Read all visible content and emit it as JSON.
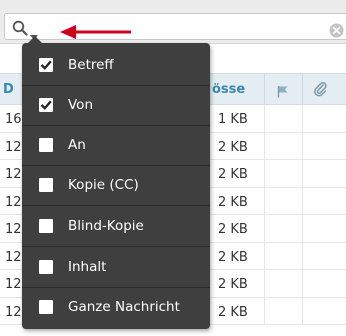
{
  "header": {
    "first_column_label": "D",
    "size_column_label": "össe"
  },
  "rows": [
    {
      "id": "16",
      "size": "1 KB"
    },
    {
      "id": "12",
      "size": "2 KB"
    },
    {
      "id": "12",
      "size": "2 KB"
    },
    {
      "id": "12",
      "size": "2 KB"
    },
    {
      "id": "12",
      "size": "2 KB"
    },
    {
      "id": "12",
      "size": "2 KB"
    },
    {
      "id": "12",
      "size": "2 KB"
    },
    {
      "id": "12",
      "size": "2 KB"
    }
  ],
  "search_filter_menu": {
    "options": [
      {
        "label": "Betreff",
        "checked": true
      },
      {
        "label": "Von",
        "checked": true
      },
      {
        "label": "An",
        "checked": false
      },
      {
        "label": "Kopie (CC)",
        "checked": false
      },
      {
        "label": "Blind-Kopie",
        "checked": false
      },
      {
        "label": "Inhalt",
        "checked": false
      },
      {
        "label": "Ganze Nachricht",
        "checked": false
      }
    ]
  },
  "icons": {
    "search": "search-icon",
    "menu": "chevron-down-icon",
    "clear": "clear-icon",
    "flag": "flag-icon",
    "attachment": "paperclip-icon",
    "annotation": "red-arrow"
  },
  "colors": {
    "menu_background": "#3f3f3f",
    "header_text": "#3a88b0",
    "annotation_arrow": "#d0021b"
  }
}
